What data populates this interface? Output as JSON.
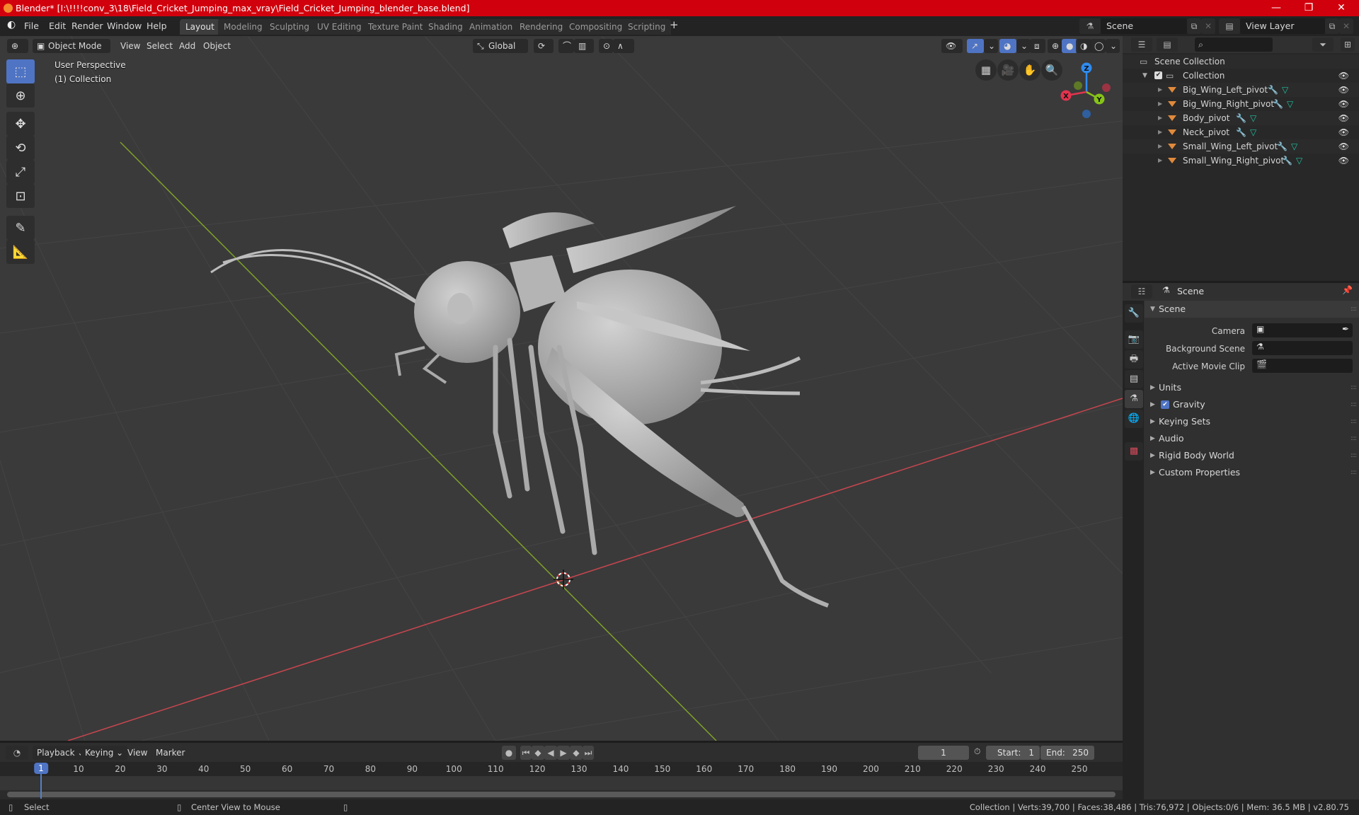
{
  "window": {
    "title": "Blender* [I:\\!!!!conv_3\\18\\Field_Cricket_Jumping_max_vray\\Field_Cricket_Jumping_blender_base.blend]",
    "minimize": "—",
    "maximize": "❐",
    "close": "✕"
  },
  "menu": [
    "File",
    "Edit",
    "Render",
    "Window",
    "Help"
  ],
  "workspaces": [
    {
      "label": "Layout",
      "active": true
    },
    {
      "label": "Modeling"
    },
    {
      "label": "Sculpting"
    },
    {
      "label": "UV Editing"
    },
    {
      "label": "Texture Paint"
    },
    {
      "label": "Shading"
    },
    {
      "label": "Animation"
    },
    {
      "label": "Rendering"
    },
    {
      "label": "Compositing"
    },
    {
      "label": "Scripting"
    }
  ],
  "add_workspace": "+",
  "scene_selector": {
    "value": "Scene"
  },
  "view_layer_selector": {
    "value": "View Layer"
  },
  "viewport_header": {
    "mode": "Object Mode",
    "menus": [
      "View",
      "Select",
      "Add",
      "Object"
    ],
    "orientation": "Global"
  },
  "viewport": {
    "perspective_label": "User Perspective",
    "collection_label": "(1) Collection",
    "gizmo": {
      "x": "X",
      "y": "Y",
      "z": "Z"
    },
    "colors": {
      "x_axis": "#c8464f",
      "y_axis": "#7fa12a",
      "z_axis": "#2f8cf0",
      "background": "#3a3a3a",
      "active_tool": "#4f74c4"
    }
  },
  "toolbar": [
    "select-box",
    "cursor",
    "move",
    "rotate",
    "scale",
    "transform",
    "annotate",
    "measure"
  ],
  "outliner": {
    "search_placeholder": "",
    "root": "Scene Collection",
    "collection": "Collection",
    "objects": [
      "Big_Wing_Left_pivot",
      "Big_Wing_Right_pivot",
      "Body_pivot",
      "Neck_pivot",
      "Small_Wing_Left_pivot",
      "Small_Wing_Right_pivot"
    ]
  },
  "properties": {
    "context": "Scene",
    "panel_title": "Scene",
    "fields": [
      {
        "label": "Camera",
        "value": ""
      },
      {
        "label": "Background Scene",
        "value": ""
      },
      {
        "label": "Active Movie Clip",
        "value": ""
      }
    ],
    "subpanels": [
      {
        "label": "Units"
      },
      {
        "label": "Gravity",
        "checkbox": true
      },
      {
        "label": "Keying Sets"
      },
      {
        "label": "Audio"
      },
      {
        "label": "Rigid Body World"
      },
      {
        "label": "Custom Properties"
      }
    ]
  },
  "timeline": {
    "menus": [
      "Playback",
      "Keying",
      "View",
      "Marker"
    ],
    "current_frame": "1",
    "start_label": "Start:",
    "start": "1",
    "end_label": "End:",
    "end": "250",
    "ticks": [
      "1",
      "10",
      "20",
      "30",
      "40",
      "50",
      "60",
      "70",
      "80",
      "90",
      "100",
      "110",
      "120",
      "130",
      "140",
      "150",
      "160",
      "170",
      "180",
      "190",
      "200",
      "210",
      "220",
      "230",
      "240",
      "250"
    ]
  },
  "statusbar": {
    "left_action": "Select",
    "middle_action": "Center View to Mouse",
    "stats": "Collection | Verts:39,700 | Faces:38,486 | Tris:76,972 | Objects:0/6 | Mem: 36.5 MB | v2.80.75"
  }
}
